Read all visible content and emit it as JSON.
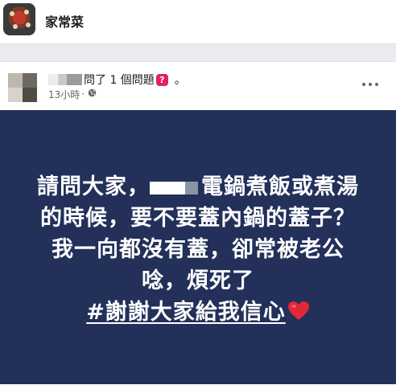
{
  "group": {
    "name": "家常菜"
  },
  "post": {
    "action_text": "問了 1 個問題",
    "question_badge": "?",
    "trailing": "。",
    "time": "13小時",
    "separator": "·",
    "icons": {
      "privacy": "globe-icon",
      "more": "more-icon",
      "emoji": "red-heart-icon"
    },
    "lines": {
      "l1_before": "請問大家，",
      "l1_after": "電鍋煮飯或煮湯",
      "l2": "的時候，要不要蓋內鍋的蓋子？",
      "l3": "我一向都沒有蓋，卻常被老公",
      "l4": "唸，煩死了",
      "hashtag": "#謝謝大家給我信心"
    },
    "background_color": "#22305a"
  }
}
